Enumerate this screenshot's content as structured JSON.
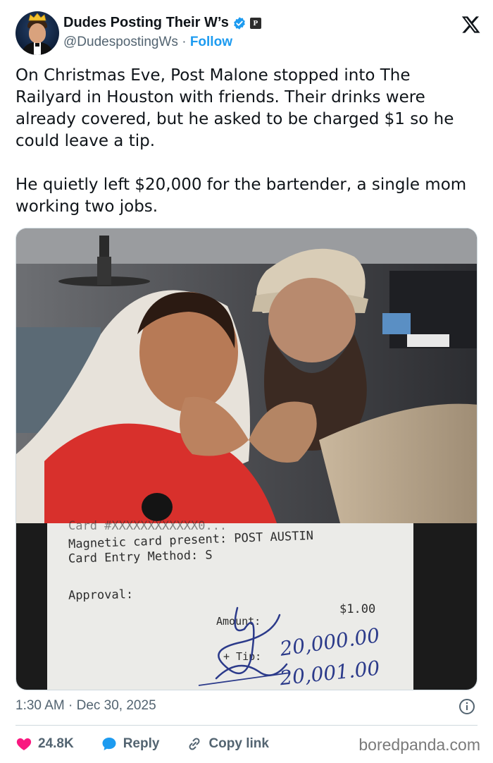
{
  "author": {
    "display_name": "Dudes Posting Their W’s",
    "handle": "@DudespostingWs",
    "separator": "·",
    "follow_label": "Follow",
    "affiliate_badge": "P"
  },
  "post": {
    "paragraphs": [
      "On Christmas Eve, Post Malone stopped into The Railyard in Houston with friends. Their drinks were already covered, but he asked to be charged $1 so he could leave a tip.",
      "He quietly left $20,000 for the bartender, a single mom working two jobs."
    ]
  },
  "receipt": {
    "line_card": "Card #XXXXXXXXXXXX0...",
    "line_magnetic": "Magnetic card present: POST AUSTIN",
    "line_entry": "Card Entry Method:  S",
    "line_approval": "Approval:",
    "amount_label": "Amount:",
    "amount_value": "$1.00",
    "tip_label": "+ Tip:",
    "tip_value": "20,000.00",
    "total_value": "20,001.00"
  },
  "timestamp": {
    "time": "1:30 AM",
    "separator": "·",
    "date": "Dec 30, 2025"
  },
  "actions": {
    "like_count": "24.8K",
    "reply_label": "Reply",
    "copy_link_label": "Copy link"
  },
  "watermark": "boredpanda.com",
  "colors": {
    "accent": "#1d9bf0",
    "like": "#f91880",
    "secondary_text": "#536471",
    "divider": "#cfd9de"
  },
  "icons": {
    "close": "x-logo-icon",
    "verified": "verified-badge-icon",
    "info": "info-icon",
    "like": "heart-icon",
    "reply": "reply-bubble-icon",
    "link": "link-icon"
  }
}
